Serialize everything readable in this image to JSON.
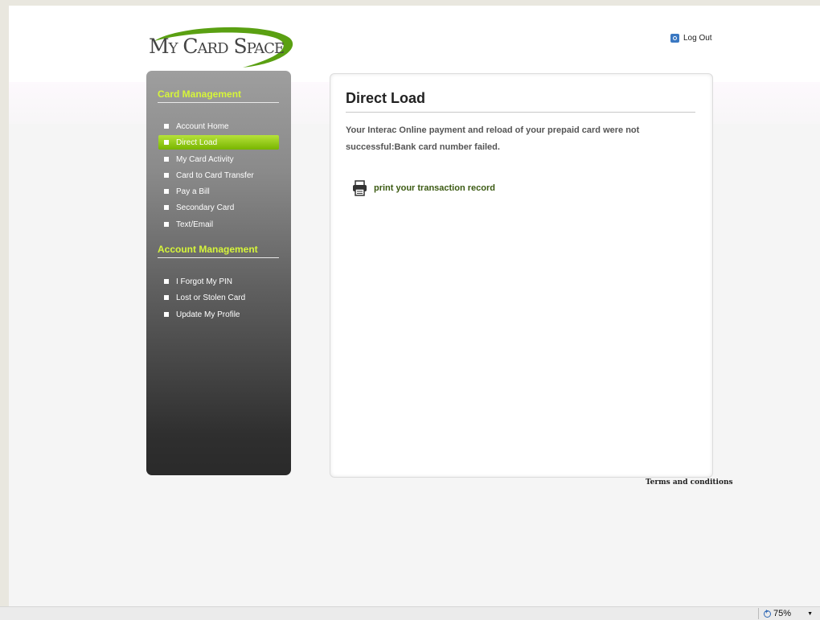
{
  "header": {
    "logo_text": "My Card Space",
    "logout_label": "Log Out"
  },
  "sidebar": {
    "card_management_heading": "Card Management",
    "card_items": [
      {
        "label": "Account Home",
        "active": false
      },
      {
        "label": "Direct Load",
        "active": true
      },
      {
        "label": "My Card Activity",
        "active": false
      },
      {
        "label": "Card to Card Transfer",
        "active": false
      },
      {
        "label": "Pay a Bill",
        "active": false
      },
      {
        "label": "Secondary Card",
        "active": false
      },
      {
        "label": "Text/Email",
        "active": false
      }
    ],
    "account_management_heading": "Account Management",
    "account_items": [
      {
        "label": "I Forgot My PIN"
      },
      {
        "label": "Lost or Stolen Card"
      },
      {
        "label": "Update My Profile"
      }
    ]
  },
  "main": {
    "title": "Direct Load",
    "message": "Your Interac Online payment and reload of your prepaid card were not successful:Bank card number failed.",
    "print_link": "print your transaction record"
  },
  "footer": {
    "terms_label": "Terms and conditions"
  },
  "statusbar": {
    "zoom_level": "75%"
  },
  "colors": {
    "accent_green": "#78b500",
    "heading_lime": "#d6f53a"
  }
}
